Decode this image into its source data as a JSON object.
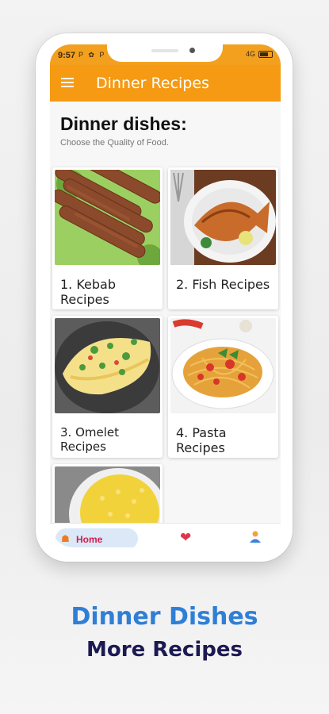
{
  "status_bar": {
    "time": "9:57",
    "left_icons": "P ✿ P",
    "right_text": "4G",
    "battery_icon": "battery-icon"
  },
  "app_bar": {
    "title": "Dinner Recipes",
    "menu_icon": "hamburger-menu-icon"
  },
  "page": {
    "heading": "Dinner dishes:",
    "subheading": "Choose the Quality of Food."
  },
  "cards": [
    {
      "label": "1. Kebab Recipes",
      "image": "kebab-image"
    },
    {
      "label": "2. Fish Recipes",
      "image": "fish-image"
    },
    {
      "label": "3. Omelet Recipes",
      "image": "omelet-image"
    },
    {
      "label": "4. Pasta Recipes",
      "image": "pasta-image"
    },
    {
      "label": "",
      "image": "rice-image"
    }
  ],
  "bottom_nav": {
    "home_label": "Home",
    "home_icon": "home-icon",
    "favorites_icon": "heart-icon",
    "profile_icon": "person-icon"
  },
  "promo": {
    "line1": "Dinner Dishes",
    "line2": "More Recipes"
  },
  "colors": {
    "accent": "#f59a12",
    "status": "#f3a01f",
    "promo_blue": "#2f7fd6",
    "promo_dark": "#1c1a52"
  }
}
